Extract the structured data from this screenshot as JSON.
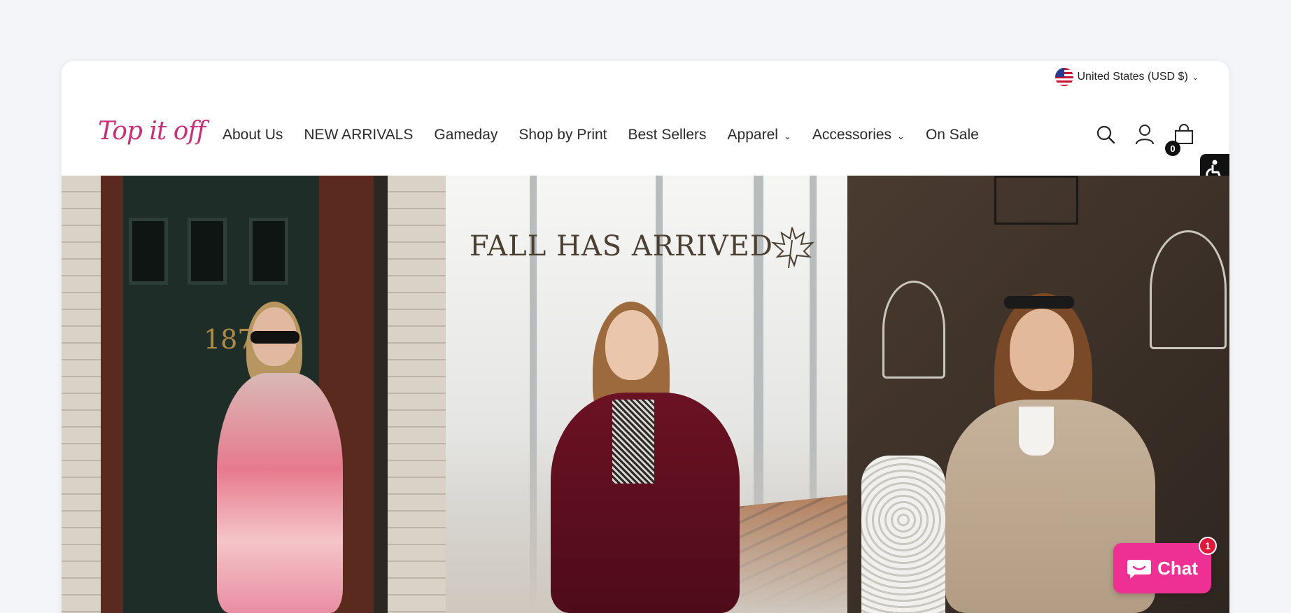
{
  "topbar": {
    "country_label": "United States (USD $)"
  },
  "header": {
    "logo_text": "Top it off"
  },
  "nav": {
    "items": [
      {
        "label": "About Us"
      },
      {
        "label": "NEW ARRIVALS"
      },
      {
        "label": "Gameday"
      },
      {
        "label": "Shop by Print"
      },
      {
        "label": "Best Sellers"
      },
      {
        "label": "Apparel"
      },
      {
        "label": "Accessories"
      },
      {
        "label": "On Sale"
      }
    ]
  },
  "cart": {
    "count": "0"
  },
  "hero": {
    "title": "FALL HAS ARRIVED",
    "door_number": "187"
  },
  "chat": {
    "label": "Chat",
    "badge": "1"
  },
  "colors": {
    "brand": "#c8307a",
    "chat": "#ee2f93"
  },
  "icons": [
    "us-flag-icon",
    "chevron-down-icon",
    "search-icon",
    "account-icon",
    "cart-icon",
    "accessibility-icon",
    "chat-bubble-icon",
    "maple-leaf-icon"
  ]
}
